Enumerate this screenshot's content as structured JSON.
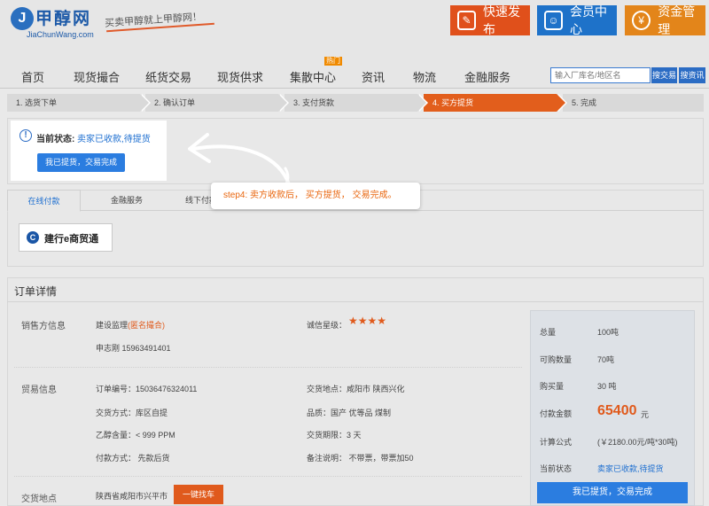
{
  "header": {
    "logo_cn": "甲醇网",
    "logo_en": "JiaChunWang.com",
    "slogan": "买卖甲醇就上甲醇网！",
    "publish_label": "快速发布",
    "member_label": "会员中心",
    "funds_label": "资金管理"
  },
  "nav": {
    "items": [
      "首页",
      "现货撮合",
      "纸货交易",
      "现货供求",
      "集散中心",
      "资讯",
      "物流",
      "金融服务"
    ],
    "hot_badge": "热门",
    "search_placeholder": "输入厂库名/地区名",
    "search_factory_label": "搜交易",
    "search_zone_label": "搜资讯"
  },
  "steps": [
    {
      "label": "1. 选货下单"
    },
    {
      "label": "2. 确认订单"
    },
    {
      "label": "3. 支付货款"
    },
    {
      "label": "4. 买方提货",
      "active": true
    },
    {
      "label": "5. 完成"
    }
  ],
  "status": {
    "label": "当前状态:",
    "value": "卖家已收款,待提货",
    "button_label": "我已提货，交易完成"
  },
  "tooltip": "step4: 卖方收款后， 买方提货， 交易完成。",
  "payment": {
    "tabs": [
      "在线付款",
      "金融服务",
      "线下付款"
    ],
    "bank_label": "建行e商贸通"
  },
  "order": {
    "title": "订单详情",
    "seller_section": "销售方信息",
    "seller_name": "建设监理",
    "seller_tag": "(匿名撮合)",
    "seller_contact": "申志刚 15963491401",
    "credit_label": "诚信星级：",
    "credit_stars": "★★★★",
    "trade_section": "贸易信息",
    "order_no": "订单编号：15036476324011",
    "delivery_place": "交货地点：咸阳市 陕西兴化",
    "delivery_mode": "交货方式：库区自提",
    "product": "品质：国产 优等品 煤制",
    "ethanol": "乙醇含量：< 999 PPM",
    "delivery_period": "交货期限：3 天",
    "pay_mode": "付款方式： 先款后货",
    "remark": "备注说明： 不带票，带票加50",
    "location_section": "交货地点",
    "location_value": "陕西省咸阳市兴平市",
    "find_car_label": "一键找车"
  },
  "summary": {
    "total_label": "总量",
    "total_value": "100吨",
    "available_label": "可购数量",
    "available_value": "70吨",
    "buy_label": "购买量",
    "buy_value": "30 吨",
    "amount_label": "付款金额",
    "amount_value": "65400",
    "amount_unit": "元",
    "formula_label": "计算公式",
    "formula_value": "(￥2180.00元/吨*30吨)",
    "state_label": "当前状态",
    "state_value": "卖家已收款,待提货",
    "button_label": "我已提货，交易完成"
  }
}
